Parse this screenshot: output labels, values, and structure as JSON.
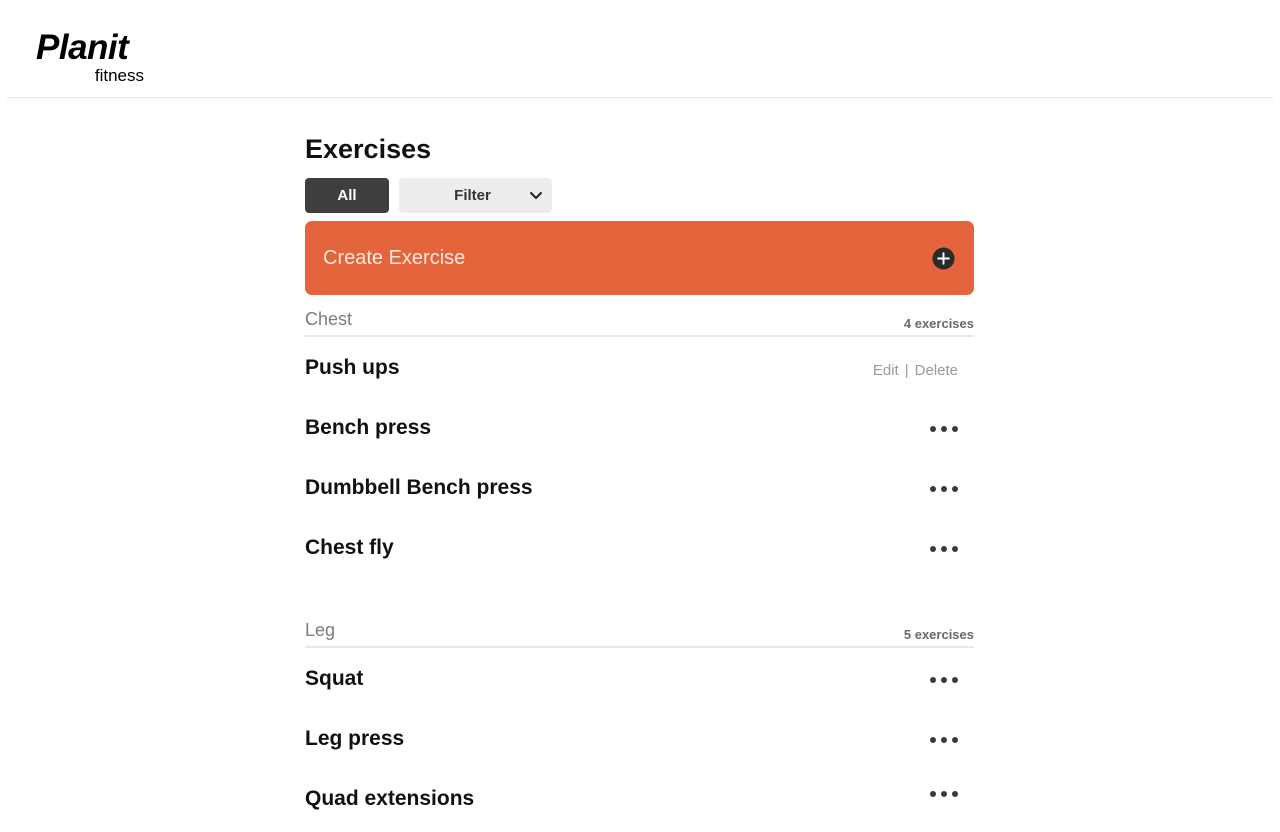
{
  "brand": {
    "name": "Planit",
    "sub": "fitness"
  },
  "page": {
    "title": "Exercises"
  },
  "filters": {
    "all_label": "All",
    "filter_label": "Filter"
  },
  "create": {
    "label": "Create Exercise"
  },
  "row_actions": {
    "edit": "Edit",
    "separator": "|",
    "delete": "Delete"
  },
  "groups": [
    {
      "name": "Chest",
      "count": "4 exercises",
      "exercises": [
        {
          "name": "Push ups"
        },
        {
          "name": "Bench press"
        },
        {
          "name": "Dumbbell Bench press"
        },
        {
          "name": "Chest fly"
        }
      ]
    },
    {
      "name": "Leg",
      "count": "5 exercises",
      "exercises": [
        {
          "name": "Squat"
        },
        {
          "name": "Leg press"
        },
        {
          "name": "Quad extensions"
        }
      ]
    }
  ],
  "colors": {
    "accent": "#e4643c",
    "dark_button": "#3f3f3f",
    "filter_bg": "#ededed"
  },
  "icons": {
    "filter_dropdown": "chevron-down-icon",
    "create": "plus-circle-icon",
    "row_menu": "more-horizontal-icon"
  }
}
